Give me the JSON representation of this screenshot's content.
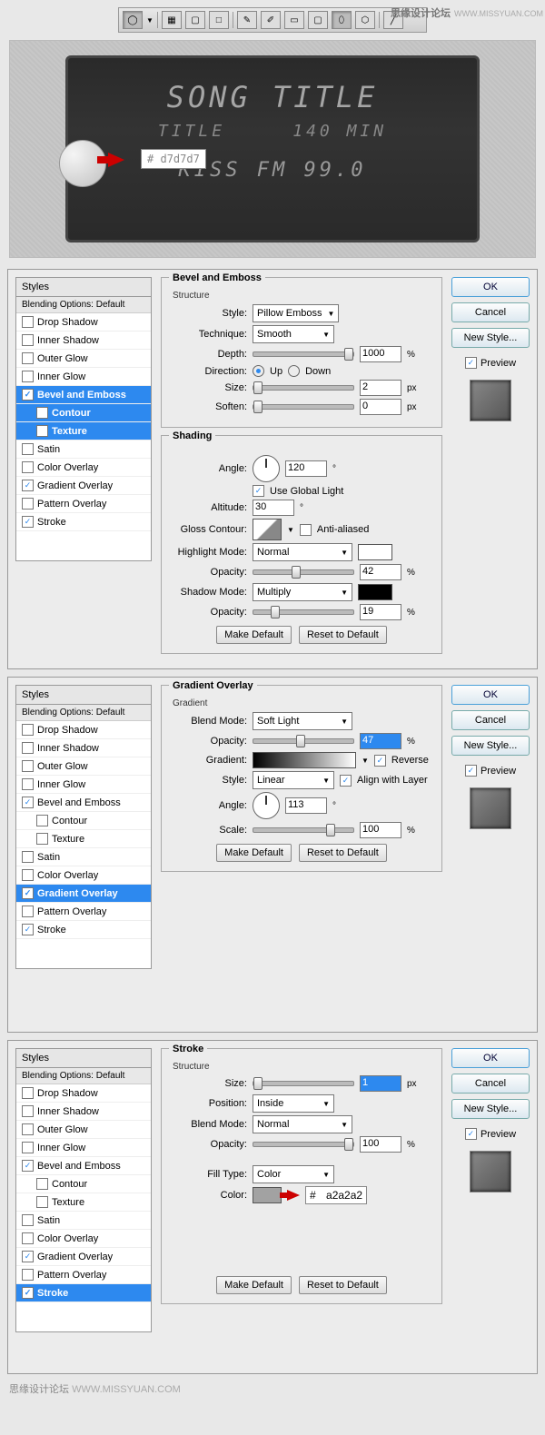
{
  "watermark": {
    "cn": "思缘设计论坛",
    "en": "WWW.MISSYUAN.COM"
  },
  "toolbar": {
    "icons": [
      "ellipse",
      "sep",
      "rect-fill",
      "rect",
      "rect-empty",
      "sep",
      "pen",
      "pen-free",
      "rect-sm",
      "rounded",
      "rounded-fill",
      "hex",
      "sep",
      "line"
    ]
  },
  "hero": {
    "line1": "SONG TITLE",
    "line2_a": "TITLE",
    "line2_b": "140 MIN",
    "line3": "KISS FM 99.0",
    "hex_prefix": "#",
    "hex_value": "d7d7d7"
  },
  "buttons": {
    "ok": "OK",
    "cancel": "Cancel",
    "newstyle": "New Style...",
    "preview": "Preview",
    "make_default": "Make Default",
    "reset_default": "Reset to Default"
  },
  "styles_label": "Styles",
  "blending_header": "Blending Options: Default",
  "effects": {
    "drop": "Drop Shadow",
    "inner_s": "Inner Shadow",
    "outer_g": "Outer Glow",
    "inner_g": "Inner Glow",
    "bevel": "Bevel and Emboss",
    "contour": "Contour",
    "texture": "Texture",
    "satin": "Satin",
    "color_o": "Color Overlay",
    "grad_o": "Gradient Overlay",
    "pat_o": "Pattern Overlay",
    "stroke": "Stroke"
  },
  "panel1": {
    "title": "Bevel and Emboss",
    "structure": "Structure",
    "style_l": "Style:",
    "style_v": "Pillow Emboss",
    "tech_l": "Technique:",
    "tech_v": "Smooth",
    "depth_l": "Depth:",
    "depth_v": "1000",
    "pct": "%",
    "dir_l": "Direction:",
    "up": "Up",
    "down": "Down",
    "size_l": "Size:",
    "size_v": "2",
    "px": "px",
    "soften_l": "Soften:",
    "soften_v": "0",
    "shading": "Shading",
    "angle_l": "Angle:",
    "angle_v": "120",
    "deg": "°",
    "ugl": "Use Global Light",
    "alt_l": "Altitude:",
    "alt_v": "30",
    "gc_l": "Gloss Contour:",
    "aa": "Anti-aliased",
    "hm_l": "Highlight Mode:",
    "hm_v": "Normal",
    "op_l": "Opacity:",
    "hop_v": "42",
    "sm_l": "Shadow Mode:",
    "sm_v": "Multiply",
    "sop_v": "19"
  },
  "panel2": {
    "title": "Gradient Overlay",
    "gradient": "Gradient",
    "bm_l": "Blend Mode:",
    "bm_v": "Soft Light",
    "op_l": "Opacity:",
    "op_v": "47",
    "pct": "%",
    "grad_l": "Gradient:",
    "reverse": "Reverse",
    "style_l": "Style:",
    "style_v": "Linear",
    "align": "Align with Layer",
    "angle_l": "Angle:",
    "angle_v": "113",
    "deg": "°",
    "scale_l": "Scale:",
    "scale_v": "100"
  },
  "panel3": {
    "title": "Stroke",
    "structure": "Structure",
    "size_l": "Size:",
    "size_v": "1",
    "px": "px",
    "pos_l": "Position:",
    "pos_v": "Inside",
    "bm_l": "Blend Mode:",
    "bm_v": "Normal",
    "op_l": "Opacity:",
    "op_v": "100",
    "pct": "%",
    "ft_l": "Fill Type:",
    "ft_v": "Color",
    "color_l": "Color:",
    "hex_prefix": "#",
    "hex_value": "a2a2a2"
  }
}
